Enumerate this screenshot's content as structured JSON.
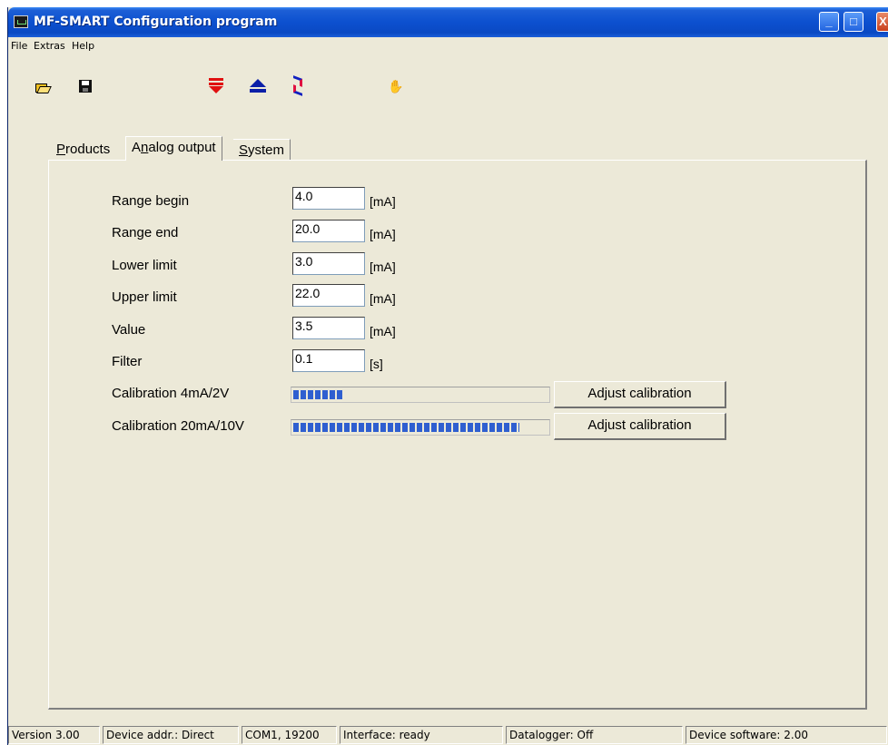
{
  "window": {
    "title": "MF-SMART Configuration program"
  },
  "titlebar_buttons": {
    "minimize": "_",
    "maximize": "□",
    "close": "X"
  },
  "menu": [
    "File",
    "Extras",
    "Help"
  ],
  "toolbar": {
    "icons": [
      "open-folder-icon",
      "save-icon",
      "download-to-device-icon",
      "eject-upload-icon",
      "swap-transfer-icon",
      "handshake-icon"
    ]
  },
  "tabs": [
    {
      "label": "Products",
      "active": false
    },
    {
      "label": "Analog output",
      "active": true
    },
    {
      "label": "System",
      "active": false
    }
  ],
  "fields": [
    {
      "label": "Range begin",
      "value": "4.0",
      "unit": "[mA]"
    },
    {
      "label": "Range end",
      "value": "20.0",
      "unit": "[mA]"
    },
    {
      "label": "Lower limit",
      "value": "3.0",
      "unit": "[mA]"
    },
    {
      "label": "Upper limit",
      "value": "22.0",
      "unit": "[mA]"
    },
    {
      "label": "Value",
      "value": "3.5",
      "unit": "[mA]"
    },
    {
      "label": "Filter",
      "value": "0.1",
      "unit": "[s]"
    }
  ],
  "calibration": [
    {
      "label": "Calibration 4mA/2V",
      "progress_fraction": 0.2,
      "button": "Adjust calibration"
    },
    {
      "label": "Calibration 20mA/10V",
      "progress_fraction": 0.89,
      "button": "Adjust calibration"
    }
  ],
  "status": {
    "version": "Version 3.00",
    "device_addr": "Device addr.: Direct",
    "port": "COM1,  19200",
    "interface": "Interface: ready",
    "datalogger": "Datalogger: Off",
    "device_software": "Device software: 2.00"
  },
  "colors": {
    "titlebar": "#0c50cf",
    "window_bg": "#ece9d8",
    "progress_fill": "#2f5fd0"
  }
}
